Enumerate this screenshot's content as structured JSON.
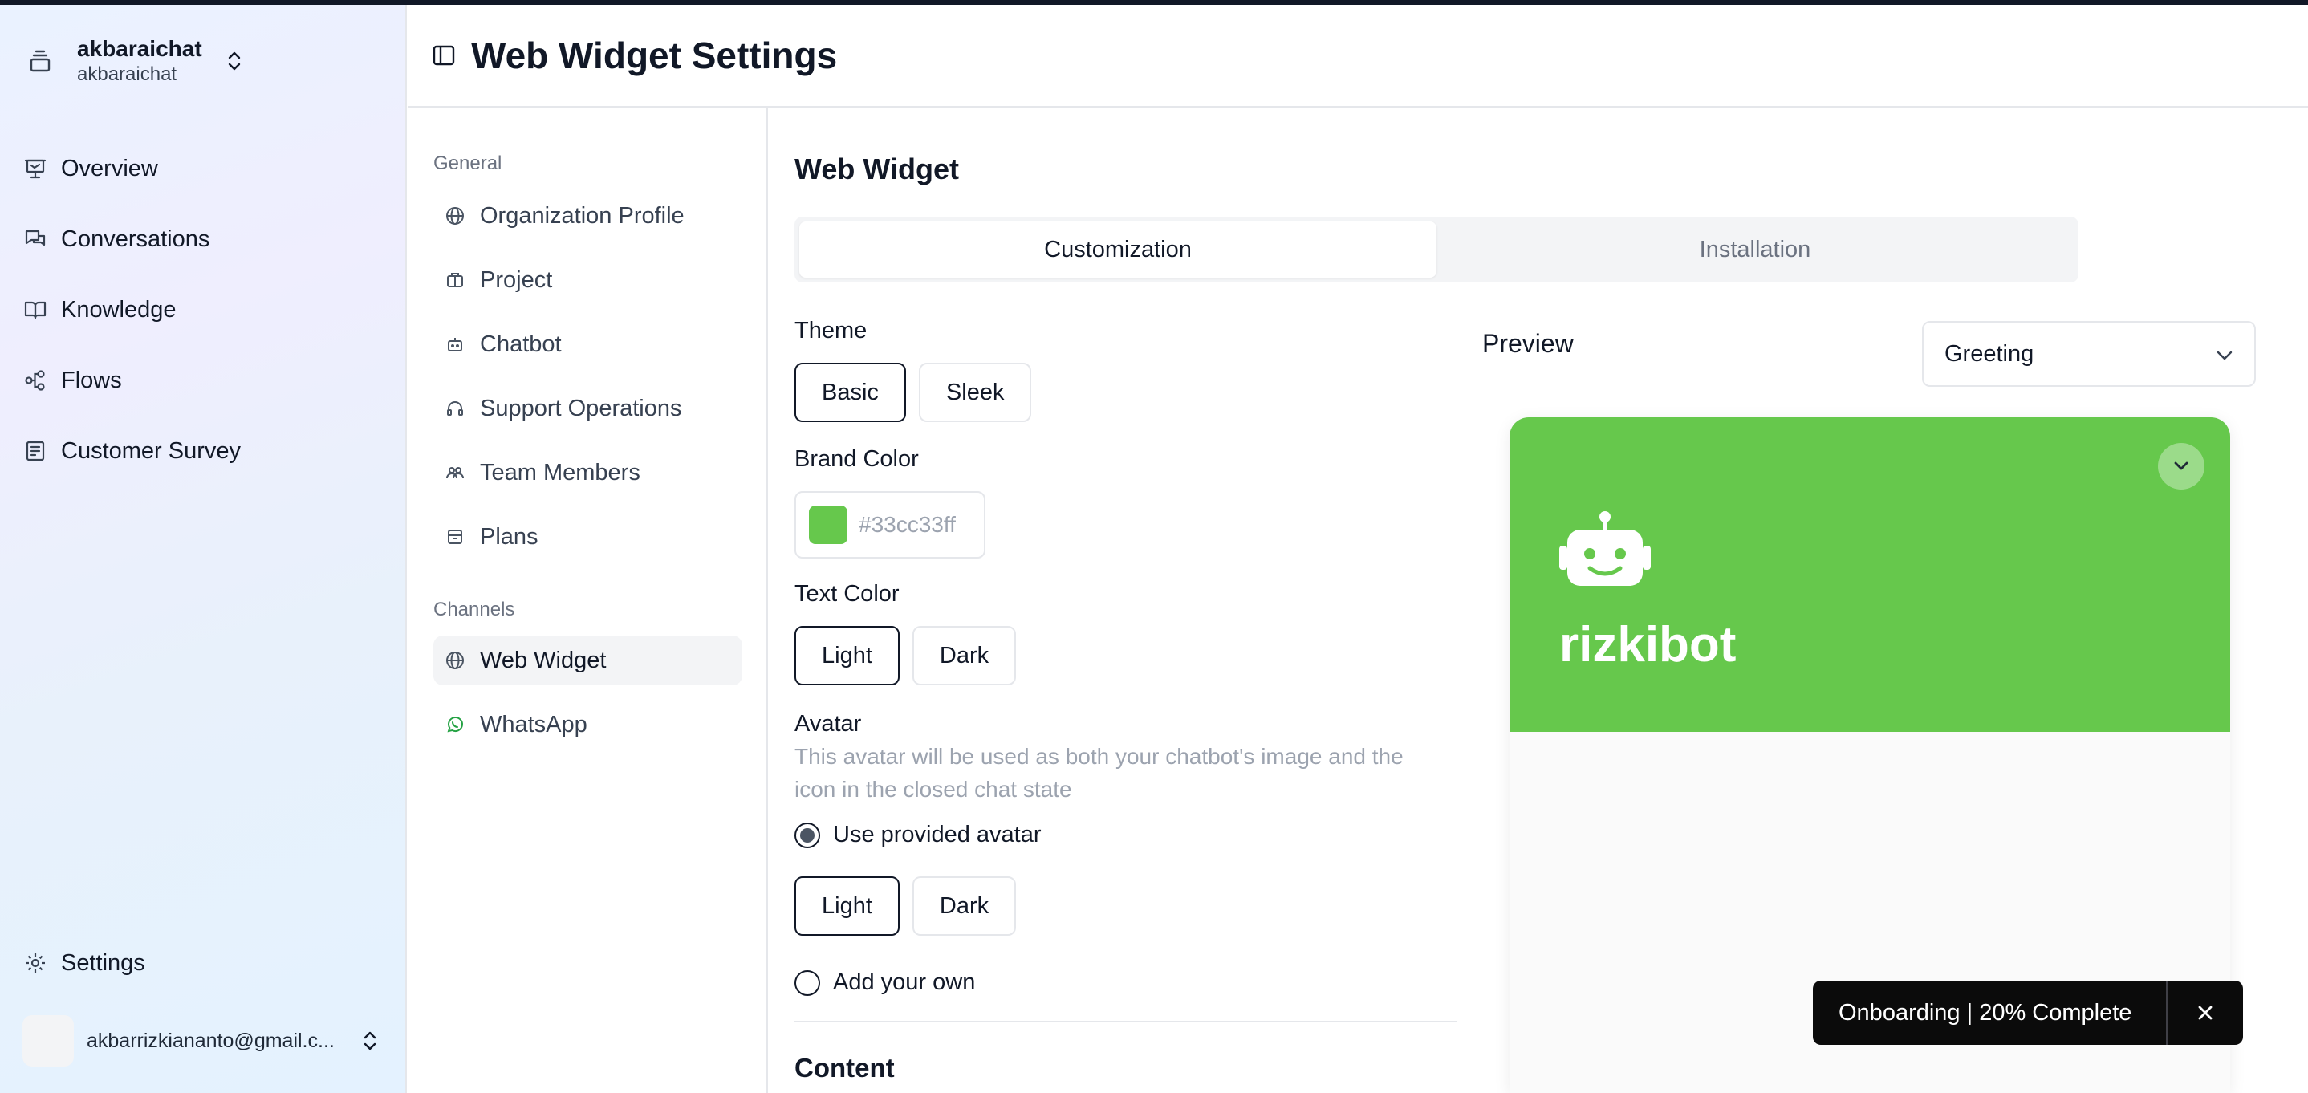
{
  "sidebar": {
    "org_name": "akbaraichat",
    "org_sub": "akbaraichat",
    "nav": [
      {
        "label": "Overview",
        "icon": "presentation-icon"
      },
      {
        "label": "Conversations",
        "icon": "chat-bubbles-icon"
      },
      {
        "label": "Knowledge",
        "icon": "book-icon"
      },
      {
        "label": "Flows",
        "icon": "workflow-icon"
      },
      {
        "label": "Customer Survey",
        "icon": "survey-icon"
      }
    ],
    "settings_label": "Settings",
    "user_email": "akbarrizkiananto@gmail.c..."
  },
  "header": {
    "title": "Web Widget Settings"
  },
  "settings_nav": {
    "general_label": "General",
    "general_items": [
      {
        "label": "Organization Profile",
        "icon": "globe-icon"
      },
      {
        "label": "Project",
        "icon": "briefcase-icon"
      },
      {
        "label": "Chatbot",
        "icon": "bot-icon"
      },
      {
        "label": "Support Operations",
        "icon": "headset-icon"
      },
      {
        "label": "Team Members",
        "icon": "users-icon"
      },
      {
        "label": "Plans",
        "icon": "archive-icon"
      }
    ],
    "channels_label": "Channels",
    "channel_items": [
      {
        "label": "Web Widget",
        "icon": "globe-icon",
        "active": true
      },
      {
        "label": "WhatsApp",
        "icon": "whatsapp-icon",
        "active": false
      }
    ]
  },
  "main": {
    "section_title": "Web Widget",
    "tabs": [
      "Customization",
      "Installation"
    ],
    "active_tab": "Customization",
    "theme": {
      "label": "Theme",
      "options": [
        "Basic",
        "Sleek"
      ],
      "selected": "Basic"
    },
    "brand_color": {
      "label": "Brand Color",
      "value": "#33cc33ff",
      "swatch": "#66c84c"
    },
    "text_color": {
      "label": "Text Color",
      "options": [
        "Light",
        "Dark"
      ],
      "selected": "Light"
    },
    "avatar": {
      "label": "Avatar",
      "help": "This avatar will be used as both your chatbot's image and the icon in the closed chat state",
      "use_provided_label": "Use provided avatar",
      "options": [
        "Light",
        "Dark"
      ],
      "selected": "Light",
      "add_own_label": "Add your own"
    },
    "content_title": "Content"
  },
  "preview": {
    "label": "Preview",
    "select_value": "Greeting",
    "bot_name": "rizkibot",
    "header_color": "#66c84c"
  },
  "toast": {
    "text": "Onboarding | 20% Complete"
  }
}
